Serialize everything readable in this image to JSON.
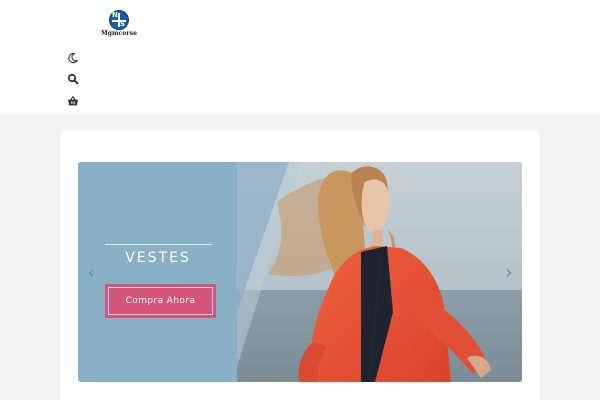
{
  "header": {
    "logo_letters": {
      "top": "N",
      "bottom": "S"
    },
    "logo_text": "Mgmcorse",
    "icons": [
      "moon-icon",
      "search-icon",
      "basket-icon"
    ]
  },
  "slider": {
    "title": "VESTES",
    "cta_label": "Compra Ahora",
    "prev_icon": "chevron-left-icon",
    "next_icon": "chevron-right-icon"
  },
  "colors": {
    "header_bg": "#ffffff",
    "page_bg": "#f4f4f4",
    "slide_panel": "#89b0c5",
    "cta": "#d3557a",
    "arrow": "#4f9aa6",
    "jacket": "#e8523a",
    "hair": "#c8965e",
    "logo": "#1b5ea8"
  }
}
